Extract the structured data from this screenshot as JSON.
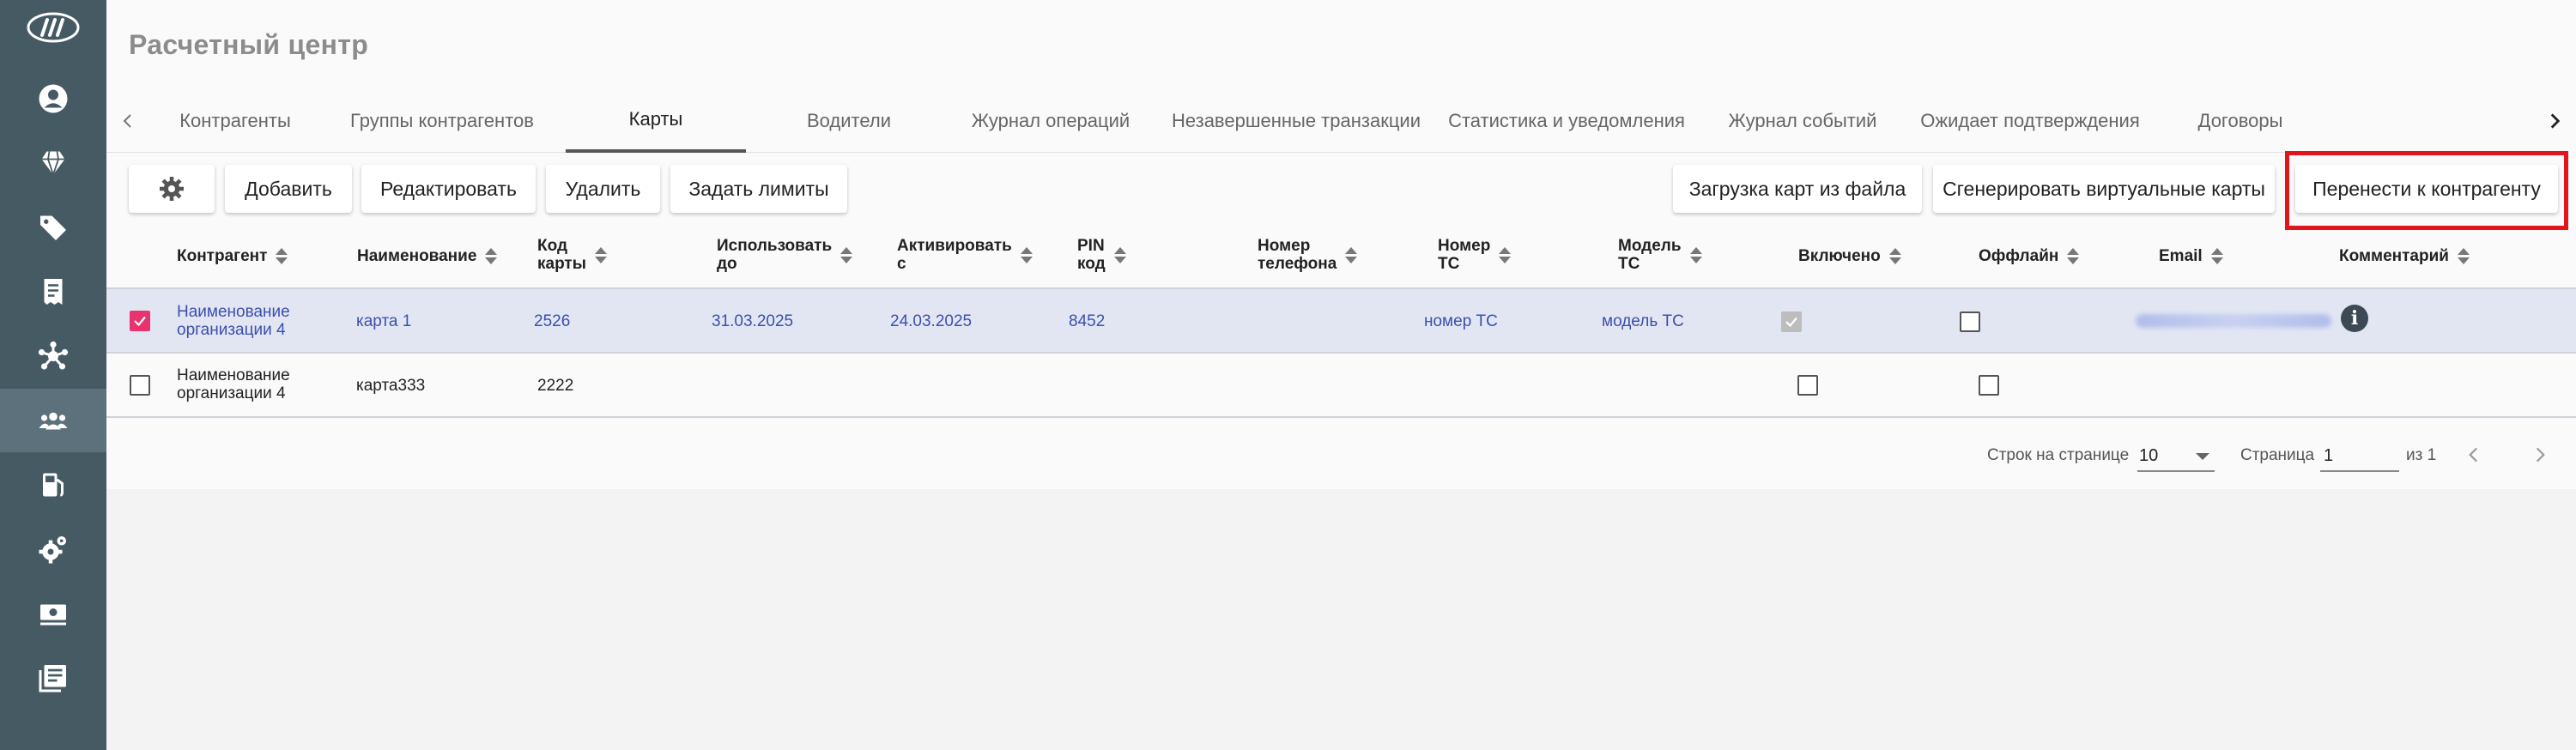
{
  "app": {
    "title": "Расчетный центр"
  },
  "sidebar": {
    "icons": [
      "logo-icon",
      "user-icon",
      "diamond-icon",
      "tags-icon",
      "receipt-icon",
      "network-icon",
      "users-icon",
      "fuel-pump-icon",
      "cog-icon",
      "cash-icon",
      "list-icon"
    ],
    "active": "users-icon"
  },
  "tabs": {
    "items": [
      {
        "label": "Контрагенты"
      },
      {
        "label": "Группы контрагентов"
      },
      {
        "label": "Карты"
      },
      {
        "label": "Водители"
      },
      {
        "label": "Журнал операций"
      },
      {
        "label": "Незавершенные транзакции"
      },
      {
        "label": "Статистика и уведомления"
      },
      {
        "label": "Журнал событий"
      },
      {
        "label": "Ожидает подтверждения"
      },
      {
        "label": "Договоры"
      }
    ],
    "active": "Карты"
  },
  "toolbar": {
    "add": "Добавить",
    "edit": "Редактировать",
    "delete": "Удалить",
    "limits": "Задать лимиты",
    "upload": "Загрузка карт из файла",
    "generate": "Сгенерировать виртуальные карты",
    "transfer": "Перенести к контрагенту"
  },
  "table": {
    "columns": [
      {
        "l1": "Контрагент",
        "l2": ""
      },
      {
        "l1": "Наименование",
        "l2": ""
      },
      {
        "l1": "Код",
        "l2": "карты"
      },
      {
        "l1": "Использовать",
        "l2": "до"
      },
      {
        "l1": "Активировать",
        "l2": "с"
      },
      {
        "l1": "PIN",
        "l2": "код"
      },
      {
        "l1": "Номер",
        "l2": "телефона"
      },
      {
        "l1": "Номер",
        "l2": "ТС"
      },
      {
        "l1": "Модель",
        "l2": "ТС"
      },
      {
        "l1": "Включено",
        "l2": ""
      },
      {
        "l1": "Оффлайн",
        "l2": ""
      },
      {
        "l1": "Email",
        "l2": ""
      },
      {
        "l1": "Комментарий",
        "l2": ""
      }
    ],
    "rows": [
      {
        "selected": true,
        "org_l1": "Наименование",
        "org_l2": "организации 4",
        "name": "карта 1",
        "code": "2526",
        "use_until": "31.03.2025",
        "activate_from": "24.03.2025",
        "pin": "8452",
        "phone": "",
        "vehicle_no": "номер ТС",
        "vehicle_model": "модель ТС",
        "enabled": true,
        "offline": false
      },
      {
        "selected": false,
        "org_l1": "Наименование",
        "org_l2": "организации 4",
        "name": "карта333",
        "code": "2222",
        "use_until": "",
        "activate_from": "",
        "pin": "",
        "phone": "",
        "vehicle_no": "",
        "vehicle_model": "",
        "enabled": false,
        "offline": false
      }
    ]
  },
  "pagination": {
    "rows_per_page_label": "Строк на странице",
    "rows_per_page": "10",
    "page_label": "Страница",
    "page": "1",
    "of_label": "из 1"
  },
  "colors": {
    "sidebar": "#465a64",
    "accent_checkbox": "#e8336f",
    "link": "#3c4fad",
    "highlight": "#e3141b"
  }
}
